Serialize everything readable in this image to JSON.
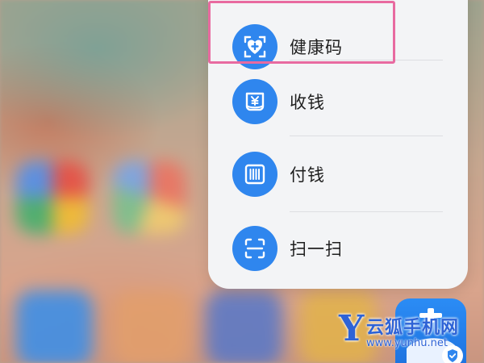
{
  "menu": {
    "items": [
      {
        "label": "健康码",
        "icon": "health-code-icon"
      },
      {
        "label": "收钱",
        "icon": "receive-money-icon"
      },
      {
        "label": "付钱",
        "icon": "pay-barcode-icon"
      },
      {
        "label": "扫一扫",
        "icon": "scan-icon"
      }
    ]
  },
  "app": {
    "icon": "alipay-app-icon"
  },
  "watermark": {
    "letter": "Y",
    "title": "云狐手机网",
    "url": "www.yunhu.net"
  },
  "colors": {
    "accent": "#2f86ee",
    "highlight": "#e86aa0",
    "menu_bg": "#f3f4f6",
    "watermark": "#2e63d6"
  }
}
